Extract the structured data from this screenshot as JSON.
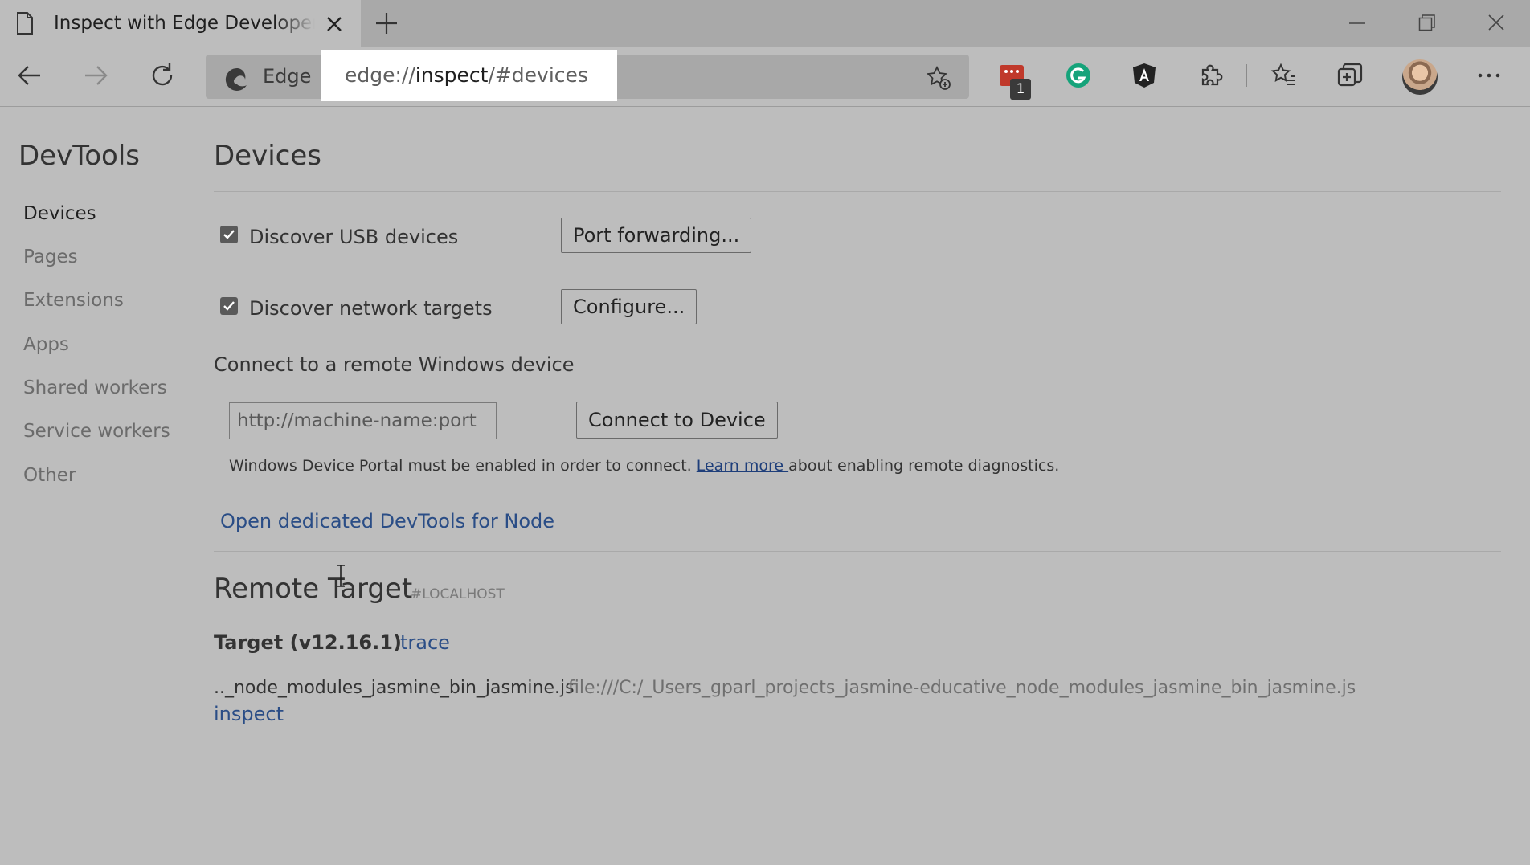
{
  "browser": {
    "tab_title": "Inspect with Edge Developer Tools",
    "address_prefix": "Edge",
    "url_scheme": "edge://",
    "url_host": "inspect",
    "url_path": "/#devices",
    "extension_badge": "1"
  },
  "sidebar": {
    "title": "DevTools",
    "items": [
      {
        "label": "Devices",
        "active": true
      },
      {
        "label": "Pages"
      },
      {
        "label": "Extensions"
      },
      {
        "label": "Apps"
      },
      {
        "label": "Shared workers"
      },
      {
        "label": "Service workers"
      },
      {
        "label": "Other"
      }
    ]
  },
  "main": {
    "heading": "Devices",
    "discover_usb_label": "Discover USB devices",
    "discover_usb_checked": true,
    "port_forwarding_button": "Port forwarding...",
    "discover_network_label": "Discover network targets",
    "discover_network_checked": true,
    "configure_button": "Configure...",
    "remote_windows_label": "Connect to a remote Windows device",
    "remote_input_placeholder": "http://machine-name:port",
    "connect_button": "Connect to Device",
    "note_before": "Windows Device Portal must be enabled in order to connect. ",
    "note_link": "Learn more ",
    "note_after": "about enabling remote diagnostics.",
    "node_devtools_link": "Open dedicated DevTools for Node"
  },
  "remote_target": {
    "heading": "Remote Target",
    "host": "#LOCALHOST",
    "target_name": "Target (v12.16.1)",
    "trace_link": "trace",
    "script_name": ".._node_modules_jasmine_bin_jasmine.js",
    "script_url": "file:///C:/_Users_gparl_projects_jasmine-educative_node_modules_jasmine_bin_jasmine.js",
    "inspect_link": "inspect"
  }
}
